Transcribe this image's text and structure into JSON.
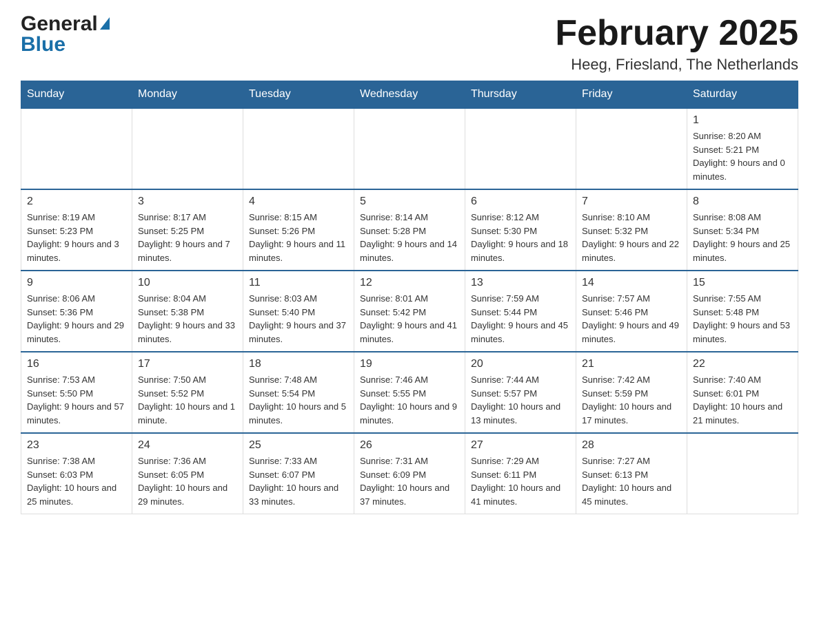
{
  "header": {
    "month_title": "February 2025",
    "location": "Heeg, Friesland, The Netherlands",
    "logo_general": "General",
    "logo_blue": "Blue"
  },
  "days_of_week": [
    "Sunday",
    "Monday",
    "Tuesday",
    "Wednesday",
    "Thursday",
    "Friday",
    "Saturday"
  ],
  "weeks": [
    [
      {
        "day": "",
        "info": ""
      },
      {
        "day": "",
        "info": ""
      },
      {
        "day": "",
        "info": ""
      },
      {
        "day": "",
        "info": ""
      },
      {
        "day": "",
        "info": ""
      },
      {
        "day": "",
        "info": ""
      },
      {
        "day": "1",
        "info": "Sunrise: 8:20 AM\nSunset: 5:21 PM\nDaylight: 9 hours and 0 minutes."
      }
    ],
    [
      {
        "day": "2",
        "info": "Sunrise: 8:19 AM\nSunset: 5:23 PM\nDaylight: 9 hours and 3 minutes."
      },
      {
        "day": "3",
        "info": "Sunrise: 8:17 AM\nSunset: 5:25 PM\nDaylight: 9 hours and 7 minutes."
      },
      {
        "day": "4",
        "info": "Sunrise: 8:15 AM\nSunset: 5:26 PM\nDaylight: 9 hours and 11 minutes."
      },
      {
        "day": "5",
        "info": "Sunrise: 8:14 AM\nSunset: 5:28 PM\nDaylight: 9 hours and 14 minutes."
      },
      {
        "day": "6",
        "info": "Sunrise: 8:12 AM\nSunset: 5:30 PM\nDaylight: 9 hours and 18 minutes."
      },
      {
        "day": "7",
        "info": "Sunrise: 8:10 AM\nSunset: 5:32 PM\nDaylight: 9 hours and 22 minutes."
      },
      {
        "day": "8",
        "info": "Sunrise: 8:08 AM\nSunset: 5:34 PM\nDaylight: 9 hours and 25 minutes."
      }
    ],
    [
      {
        "day": "9",
        "info": "Sunrise: 8:06 AM\nSunset: 5:36 PM\nDaylight: 9 hours and 29 minutes."
      },
      {
        "day": "10",
        "info": "Sunrise: 8:04 AM\nSunset: 5:38 PM\nDaylight: 9 hours and 33 minutes."
      },
      {
        "day": "11",
        "info": "Sunrise: 8:03 AM\nSunset: 5:40 PM\nDaylight: 9 hours and 37 minutes."
      },
      {
        "day": "12",
        "info": "Sunrise: 8:01 AM\nSunset: 5:42 PM\nDaylight: 9 hours and 41 minutes."
      },
      {
        "day": "13",
        "info": "Sunrise: 7:59 AM\nSunset: 5:44 PM\nDaylight: 9 hours and 45 minutes."
      },
      {
        "day": "14",
        "info": "Sunrise: 7:57 AM\nSunset: 5:46 PM\nDaylight: 9 hours and 49 minutes."
      },
      {
        "day": "15",
        "info": "Sunrise: 7:55 AM\nSunset: 5:48 PM\nDaylight: 9 hours and 53 minutes."
      }
    ],
    [
      {
        "day": "16",
        "info": "Sunrise: 7:53 AM\nSunset: 5:50 PM\nDaylight: 9 hours and 57 minutes."
      },
      {
        "day": "17",
        "info": "Sunrise: 7:50 AM\nSunset: 5:52 PM\nDaylight: 10 hours and 1 minute."
      },
      {
        "day": "18",
        "info": "Sunrise: 7:48 AM\nSunset: 5:54 PM\nDaylight: 10 hours and 5 minutes."
      },
      {
        "day": "19",
        "info": "Sunrise: 7:46 AM\nSunset: 5:55 PM\nDaylight: 10 hours and 9 minutes."
      },
      {
        "day": "20",
        "info": "Sunrise: 7:44 AM\nSunset: 5:57 PM\nDaylight: 10 hours and 13 minutes."
      },
      {
        "day": "21",
        "info": "Sunrise: 7:42 AM\nSunset: 5:59 PM\nDaylight: 10 hours and 17 minutes."
      },
      {
        "day": "22",
        "info": "Sunrise: 7:40 AM\nSunset: 6:01 PM\nDaylight: 10 hours and 21 minutes."
      }
    ],
    [
      {
        "day": "23",
        "info": "Sunrise: 7:38 AM\nSunset: 6:03 PM\nDaylight: 10 hours and 25 minutes."
      },
      {
        "day": "24",
        "info": "Sunrise: 7:36 AM\nSunset: 6:05 PM\nDaylight: 10 hours and 29 minutes."
      },
      {
        "day": "25",
        "info": "Sunrise: 7:33 AM\nSunset: 6:07 PM\nDaylight: 10 hours and 33 minutes."
      },
      {
        "day": "26",
        "info": "Sunrise: 7:31 AM\nSunset: 6:09 PM\nDaylight: 10 hours and 37 minutes."
      },
      {
        "day": "27",
        "info": "Sunrise: 7:29 AM\nSunset: 6:11 PM\nDaylight: 10 hours and 41 minutes."
      },
      {
        "day": "28",
        "info": "Sunrise: 7:27 AM\nSunset: 6:13 PM\nDaylight: 10 hours and 45 minutes."
      },
      {
        "day": "",
        "info": ""
      }
    ]
  ]
}
